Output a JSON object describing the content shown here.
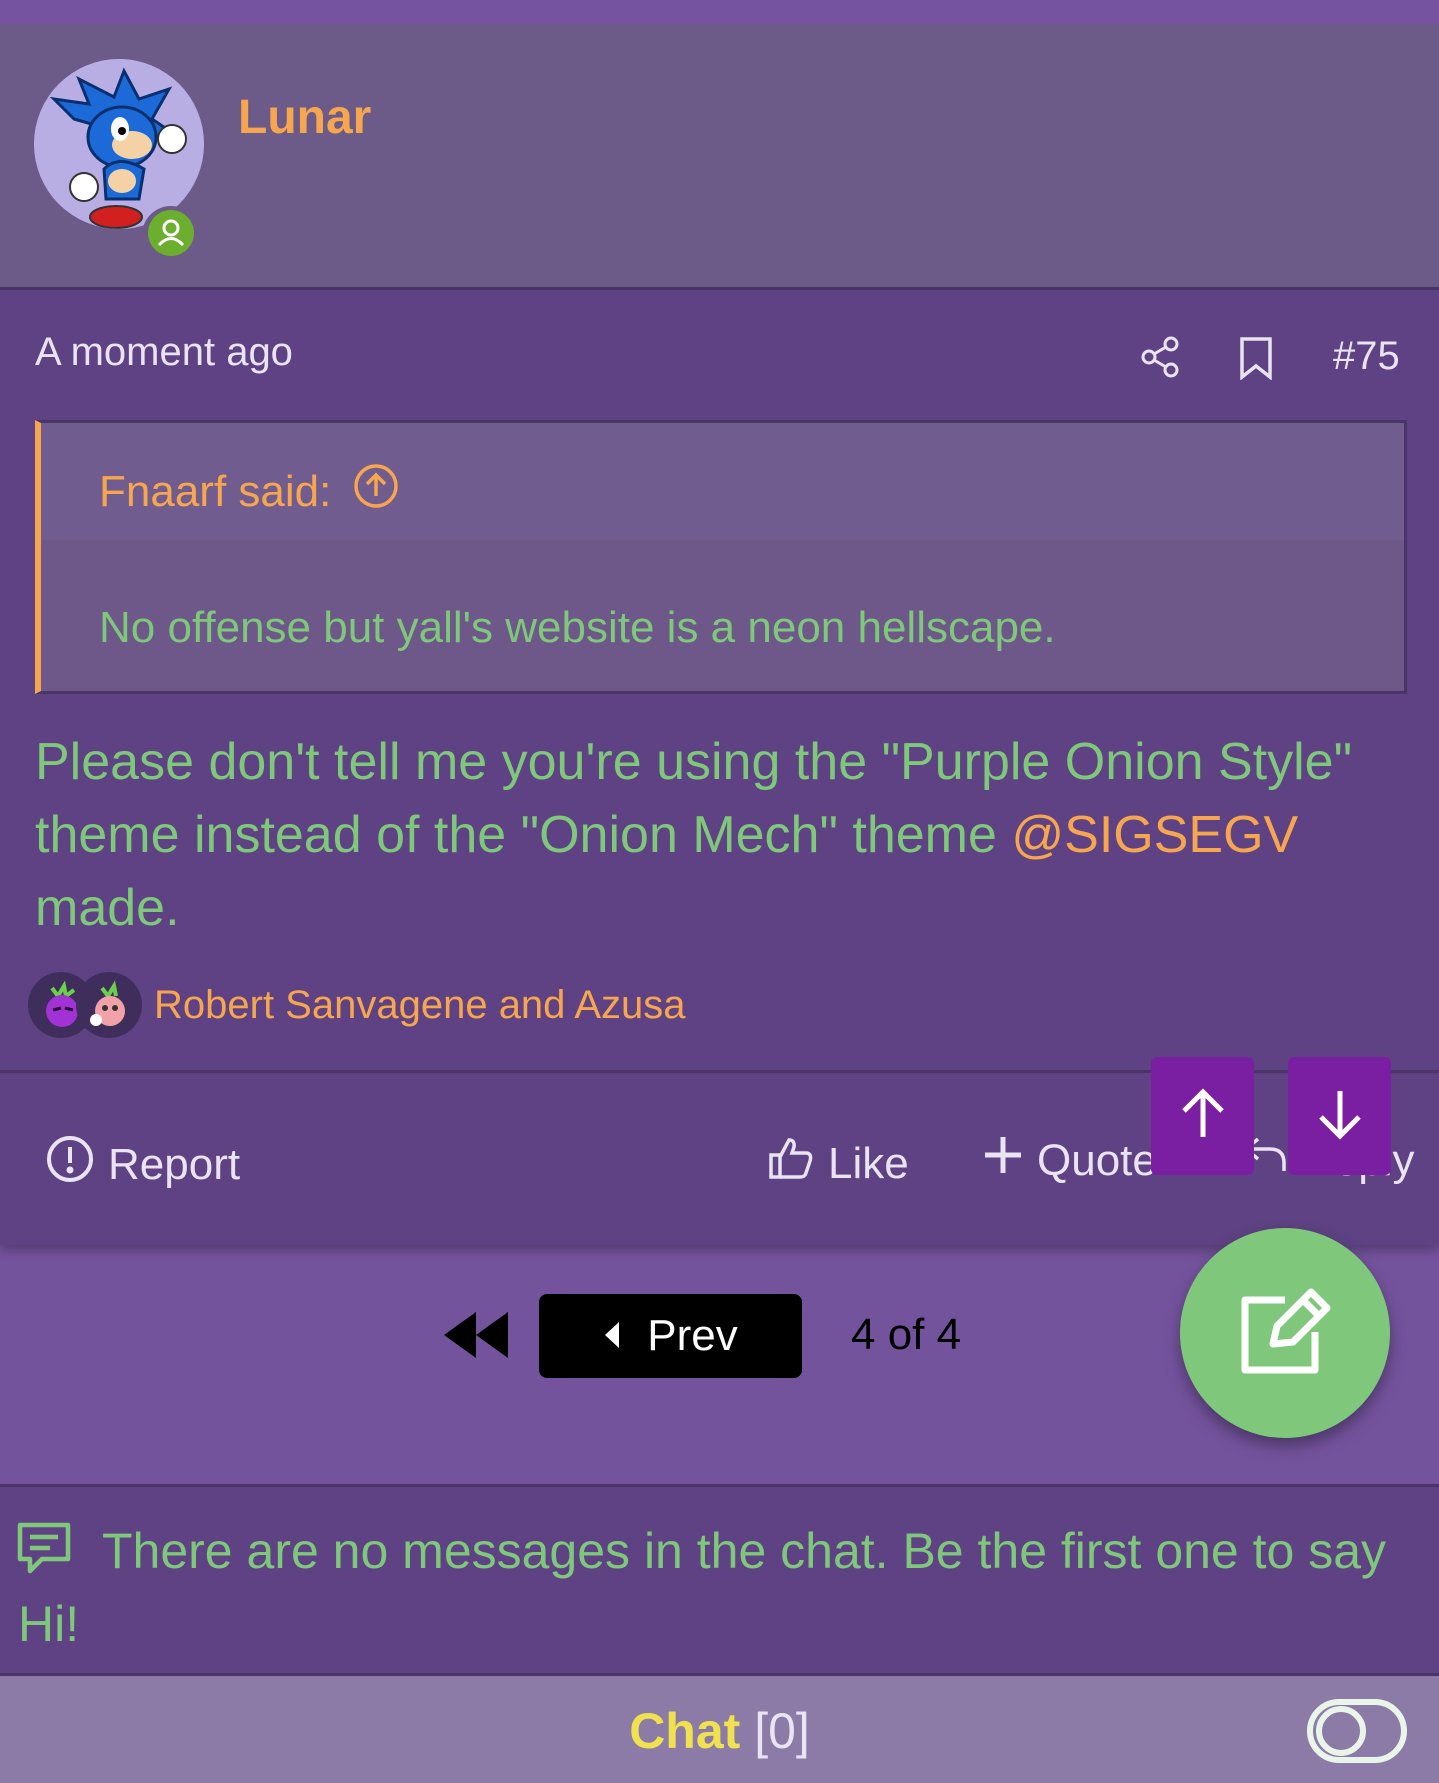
{
  "user": {
    "name": "Lunar",
    "status_icon": "user-online-icon"
  },
  "post": {
    "time": "A moment ago",
    "number": "#75",
    "quote": {
      "author_label": "Fnaarf said:",
      "text": "No offense but yall's website is a neon hellscape."
    },
    "body_before": "Please don't tell me you're using the \"Purple Onion Style\" theme instead of the \"Onion Mech\" theme ",
    "mention": "@SIGSEGV",
    "body_after": " made.",
    "reactions": {
      "names": "Robert Sanvagene and Azusa"
    },
    "actions": {
      "report": "Report",
      "like": "Like",
      "quote": "Quote",
      "reply": "Reply"
    }
  },
  "pagination": {
    "prev": "Prev",
    "count": "4 of 4"
  },
  "chat": {
    "empty_message": "There are no messages in the chat. Be the first one to say Hi!",
    "label": "Chat",
    "count": "[0]"
  },
  "colors": {
    "accent": "#f6a64e",
    "text_green": "#7fc77a",
    "background": "#74539d",
    "panel": "#5e4283",
    "scroll_button": "#7b1fa2"
  }
}
